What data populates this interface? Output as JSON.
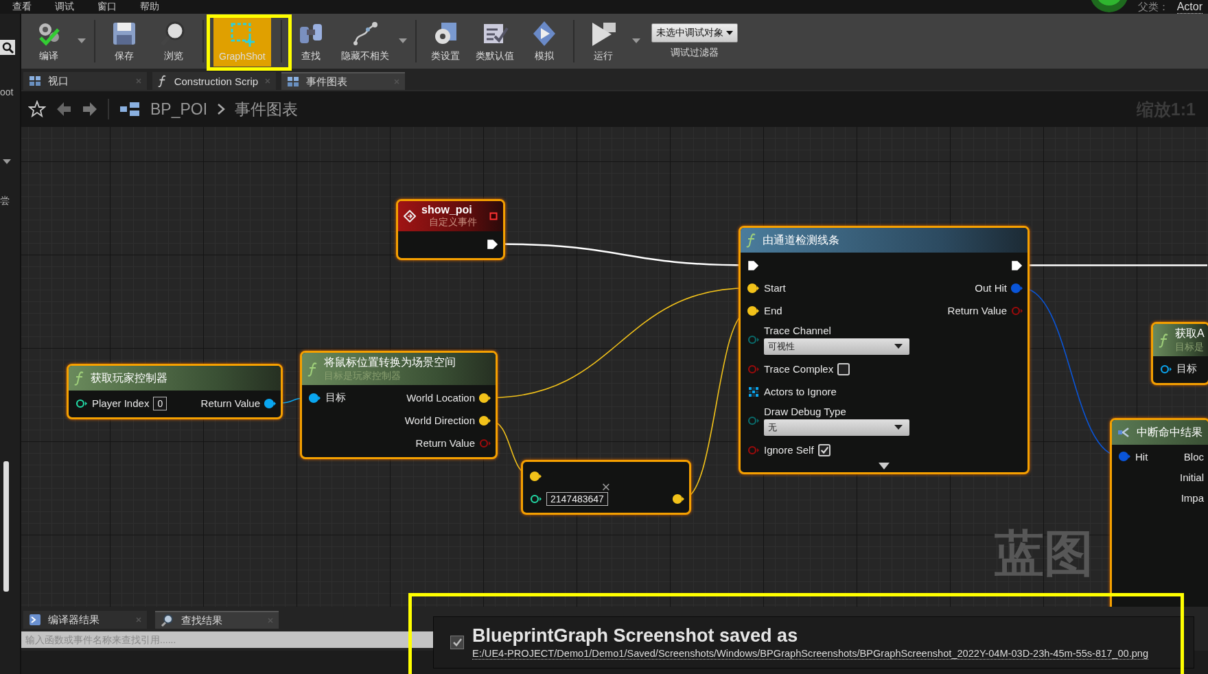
{
  "menu_bar": {
    "items": [
      "查看",
      "调试",
      "窗口",
      "帮助"
    ],
    "parent_class_label": "父类：",
    "parent_class": "Actor"
  },
  "left_panel": {
    "texts": [
      "oot",
      "尝"
    ]
  },
  "toolbar": {
    "buttons": [
      {
        "label": "编译",
        "has_dropdown": true,
        "selected": false
      },
      {
        "label": "保存",
        "selected": false
      },
      {
        "label": "浏览",
        "selected": false
      },
      {
        "label": "GraphShot",
        "selected": true,
        "highlighted": true
      },
      {
        "label": "查找",
        "selected": false
      },
      {
        "label": "隐藏不相关",
        "has_dropdown": true,
        "selected": false
      },
      {
        "label": "类设置",
        "selected": false
      },
      {
        "label": "类默认值",
        "selected": false
      },
      {
        "label": "模拟",
        "selected": false
      },
      {
        "label": "运行",
        "has_dropdown": true,
        "selected": false
      }
    ],
    "debug_object": "未选中调试对象",
    "debug_filter_label": "调试过滤器"
  },
  "tabs": [
    {
      "label": "视口",
      "selected": false
    },
    {
      "label": "Construction Scrip",
      "selected": false
    },
    {
      "label": "事件图表",
      "selected": true
    }
  ],
  "breadcrumb": {
    "items": [
      "BP_POI",
      "事件图表"
    ],
    "zoom": "缩放1:1"
  },
  "graph": {
    "watermark": "蓝图",
    "nodes": [
      {
        "kind": "event",
        "selected": true,
        "title": "show_poi",
        "subtitle": "自定义事件",
        "has_delegate_pin": true,
        "rows": [
          {
            "output": {
              "kind": "exec",
              "connected": true
            }
          }
        ]
      },
      {
        "kind": "pure",
        "selected": true,
        "title": "获取玩家控制器",
        "rows": [
          {
            "input": {
              "kind": "int",
              "label": "Player Index",
              "connected": false,
              "widget": {
                "kind": "text",
                "value": "0"
              }
            },
            "output": {
              "kind": "object",
              "label": "Return Value",
              "connected": true
            }
          }
        ]
      },
      {
        "kind": "pure",
        "selected": true,
        "title": "将鼠标位置转换为场景空间",
        "subtitle": "目标是玩家控制器",
        "rows": [
          {
            "input": {
              "kind": "object",
              "label": "目标",
              "connected": true
            },
            "output": {
              "kind": "vector",
              "label": "World Location",
              "connected": true
            }
          },
          {
            "output": {
              "kind": "vector",
              "label": "World Direction",
              "connected": true
            }
          },
          {
            "output": {
              "kind": "bool",
              "label": "Return Value",
              "connected": false
            }
          }
        ]
      },
      {
        "kind": "compact",
        "selected": true,
        "title": "×",
        "rows": [
          {
            "input": {
              "kind": "vector",
              "connected": true
            }
          },
          {
            "input": {
              "kind": "int",
              "connected": false,
              "widget": {
                "kind": "text",
                "value": "2147483647"
              }
            },
            "output": {
              "kind": "vector",
              "connected": true
            }
          }
        ]
      },
      {
        "kind": "function",
        "selected": true,
        "title": "由通道检测线条",
        "expander": true,
        "rows": [
          {
            "input": {
              "kind": "exec",
              "connected": true
            },
            "output": {
              "kind": "exec",
              "connected": true
            }
          },
          {
            "input": {
              "kind": "vector",
              "label": "Start",
              "connected": true
            },
            "output": {
              "kind": "struct",
              "label": "Out Hit",
              "connected": true
            }
          },
          {
            "input": {
              "kind": "vector",
              "label": "End",
              "connected": true
            },
            "output": {
              "kind": "bool",
              "label": "Return Value",
              "connected": false
            }
          },
          {
            "input": {
              "kind": "byte",
              "label": "Trace Channel",
              "connected": false,
              "widget": {
                "kind": "dropdown",
                "value": "可视性"
              }
            }
          },
          {
            "input": {
              "kind": "bool",
              "label": "Trace Complex",
              "connected": false,
              "widget": {
                "kind": "checkbox",
                "checked": false
              }
            }
          },
          {
            "input": {
              "kind": "array",
              "label": "Actors to Ignore",
              "connected": false
            }
          },
          {
            "input": {
              "kind": "byte",
              "label": "Draw Debug Type",
              "connected": false,
              "widget": {
                "kind": "dropdown",
                "value": "无"
              }
            }
          },
          {
            "input": {
              "kind": "bool",
              "label": "Ignore Self",
              "connected": false,
              "widget": {
                "kind": "checkbox",
                "checked": true
              }
            }
          }
        ]
      },
      {
        "kind": "pure",
        "selected": true,
        "title": "获取A",
        "subtitle": "目标是",
        "rows": [
          {
            "input": {
              "kind": "object",
              "label": "目标",
              "connected": false
            }
          }
        ]
      },
      {
        "kind": "break",
        "selected": true,
        "title": "中断命中结果",
        "rows": [
          {
            "input": {
              "kind": "struct",
              "label": "Hit",
              "connected": true
            },
            "output": {
              "label": "Bloc"
            }
          },
          {
            "output": {
              "label": "Initial"
            }
          },
          {
            "output": {
              "label": "Impa"
            }
          }
        ]
      }
    ]
  },
  "bottom_panel": {
    "tabs": [
      {
        "label": "编译器结果",
        "selected": false
      },
      {
        "label": "查找结果",
        "selected": true
      }
    ],
    "search_placeholder": "输入函数或事件名称来查找引用......"
  },
  "notification": {
    "highlighted": true,
    "checked": true,
    "title": "BlueprintGraph Screenshot saved as",
    "link": "E:/UE4-PROJECT/Demo1/Demo1/Saved/Screenshots/Windows/BPGraphScreenshots/BPGraphScreenshot_2022Y-04M-03D-23h-45m-55s-817_00.png"
  }
}
